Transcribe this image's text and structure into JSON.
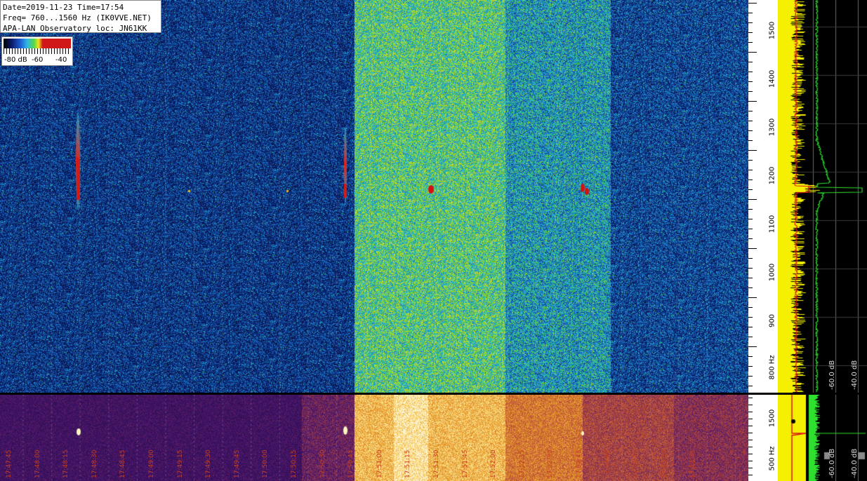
{
  "info": {
    "line1": "Date=2019-11-23 Time=17:54",
    "line2": "Freq= 760...1560 Hz (IK0VVE.NET)",
    "line3": "APA-LAN Observatory loc: JN61KK"
  },
  "legend": {
    "label_a": "-80 dB",
    "label_b": "-60",
    "label_c": "-40"
  },
  "top_axis": {
    "ticks": [
      "1500",
      "1400",
      "1300",
      "1200",
      "1100",
      "1000",
      "900",
      "800 Hz"
    ]
  },
  "bottom_axis": {
    "ticks": [
      "1500",
      "500 Hz"
    ]
  },
  "top_spectrum": {
    "label_a": "-60.0 dB",
    "label_b": "-40.0 dB"
  },
  "bottom_spectrum": {
    "label_a": "-60.0 dB",
    "label_b": "-40.0 dB"
  },
  "time_labels": [
    "17:47:45",
    "17:48:00",
    "17:48:15",
    "17:48:30",
    "17:48:45",
    "17:49:00",
    "17:49:15",
    "17:49:30",
    "17:49:45",
    "17:50:00",
    "17:50:15",
    "17:50:30",
    "17:50:45",
    "17:51:00",
    "17:51:15",
    "17:51:30",
    "17:51:45",
    "17:52:00",
    "17:52:15",
    "17:52:30",
    "17:52:45",
    "17:53:00",
    "17:53:15",
    "17:53:30",
    "17:53:45"
  ],
  "colors": {
    "waterfall_bg": "#071a4a",
    "waterfall_active": "#3fae4a",
    "echo_red": "#d41010",
    "spectrum_yellow": "#f4f000",
    "spectrum_green": "#2fe02f"
  }
}
